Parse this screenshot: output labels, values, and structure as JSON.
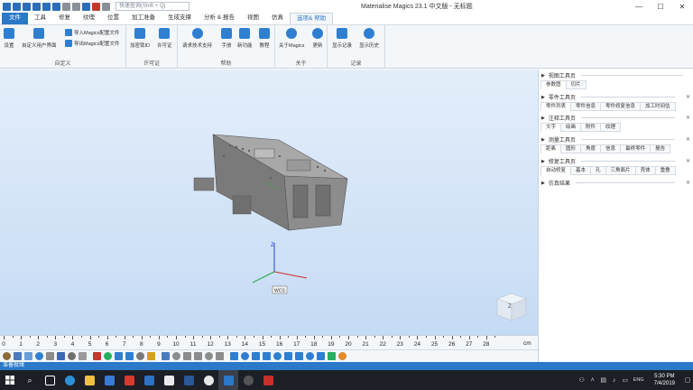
{
  "titlebar": {
    "search_placeholder": "快速查询(Shift + Q)",
    "title": "Materialise Magics 23.1 中文版 - 无标题",
    "minimize": "—",
    "maximize": "☐",
    "close": "✕"
  },
  "menu": {
    "tabs": [
      "文件",
      "工具",
      "修复",
      "纹理",
      "位置",
      "加工准备",
      "生成支撑",
      "分析 & 报告",
      "视图",
      "仿真",
      "选项& 帮助"
    ]
  },
  "ribbon": {
    "groups": {
      "customize": {
        "label": "自定义",
        "settings": "设置",
        "custom_ui": "自定义用户界面",
        "import_cfg": "导入Magics配置文件",
        "export_cfg": "导出Magics配置文件"
      },
      "license": {
        "label": "许可证",
        "dongle": "加密锁ID",
        "license": "许可证"
      },
      "help": {
        "label": "帮助",
        "support": "请求技术支持",
        "manual": "手册",
        "new_features": "新功能",
        "tutorial": "教程"
      },
      "about": {
        "label": "关于",
        "about": "关于Magics",
        "update": "更新"
      },
      "log": {
        "label": "记录",
        "show_log": "显示记录",
        "show_history": "显示历史"
      }
    }
  },
  "viewport": {
    "axis_z": "Z",
    "wcs_label": "WCS",
    "navcube_label": "Z"
  },
  "right_panel": {
    "sections": [
      {
        "title": "视图工具页",
        "tabs": [
          "参数图",
          "切片"
        ]
      },
      {
        "title": "零件工具页",
        "tabs": [
          "零件列表",
          "零件信息",
          "零件修复信息",
          "加工时间估"
        ]
      },
      {
        "title": "注释工具页",
        "tabs": [
          "文字",
          "绘画",
          "附件",
          "纹理"
        ]
      },
      {
        "title": "测量工具页",
        "tabs": [
          "距离",
          "圆形",
          "角度",
          "信息",
          "最终零件",
          "报告"
        ]
      },
      {
        "title": "修复工具页",
        "tabs": [
          "自动修复",
          "基本",
          "孔",
          "三角面片",
          "壳体",
          "重叠"
        ]
      },
      {
        "title": "仿真结果",
        "tabs": []
      }
    ]
  },
  "ruler": {
    "numbers": [
      "0",
      "1",
      "2",
      "3",
      "4",
      "5",
      "6",
      "7",
      "8",
      "9",
      "10",
      "11",
      "12",
      "13",
      "14",
      "15",
      "16",
      "17",
      "18",
      "19",
      "20",
      "21",
      "22",
      "23",
      "24",
      "25",
      "26",
      "27",
      "28"
    ],
    "unit": "cm"
  },
  "status": {
    "text": "准备就绪"
  },
  "taskbar": {
    "time": "5:30 PM",
    "date": "7/4/2019",
    "lang": "ENG"
  },
  "colors": {
    "accent": "#2b79c8",
    "viewport_top": "#e4eefb",
    "viewport_bottom": "#c5dbf4",
    "taskbar": "#1c1f26"
  }
}
